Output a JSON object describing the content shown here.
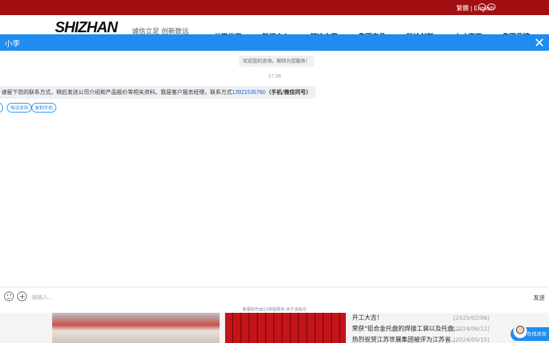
{
  "site": {
    "topbar_links": "繁體 | English",
    "logo_text": "SHIZHAN",
    "slogan": "诚信立足 创新致远",
    "nav_items": [
      "关于世展",
      "新闻中心",
      "解决方案",
      "集团产品",
      "科技创新",
      "人才资源",
      "集团品牌"
    ],
    "news": [
      {
        "title": "开工大吉！",
        "date": "[2025/02/06]"
      },
      {
        "title": "荣获\"铝合金托盘的焊接工装以及托盘…",
        "date": "[2024/06/12]"
      },
      {
        "title": "热烈祝贺江苏世展集团被评为江苏省…",
        "date": "[2024/05/15]"
      }
    ]
  },
  "chat": {
    "title": "小李",
    "welcome": "欢迎您的咨询，期待为您服务！",
    "time": "17:38",
    "message_prefix": "请留下您的联系方式，稍后发送公司介绍和产品报价等相关资料。我是客户服务经理，联系方式",
    "phone": "13921535760",
    "message_suffix": "（手机/微信同号）",
    "chips": [
      "电话咨询",
      "复制手机"
    ],
    "input_placeholder": "请输入…",
    "send_label": "发送",
    "footer_note": "客服软件由53快服提供   关于该账号"
  },
  "floating": {
    "online_label": "在线咨询"
  },
  "colors": {
    "brand_red": "#a10f12",
    "chat_blue": "#1e8cf0"
  }
}
